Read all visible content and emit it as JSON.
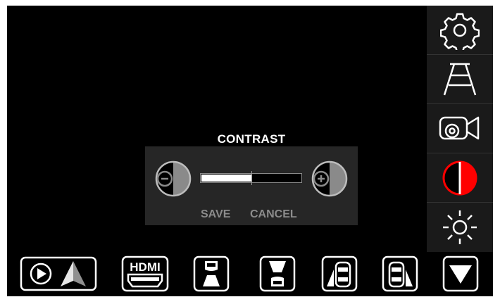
{
  "contrast": {
    "title": "CONTRAST",
    "level": 0.5,
    "save_label": "SAVE",
    "cancel_label": "CANCEL"
  },
  "sidebar": {
    "items": [
      "gear-icon",
      "parking-lines-icon",
      "camera-settings-icon",
      "contrast-icon",
      "brightness-icon"
    ],
    "active_color": "#ff0000"
  },
  "bottom_bar": {
    "items": [
      "carplay-icon",
      "hdmi-icon",
      "front-view-icon",
      "rear-view-icon",
      "left-view-icon",
      "right-view-icon",
      "dropdown-arrow-icon"
    ],
    "hdmi_text": "HDMI"
  }
}
